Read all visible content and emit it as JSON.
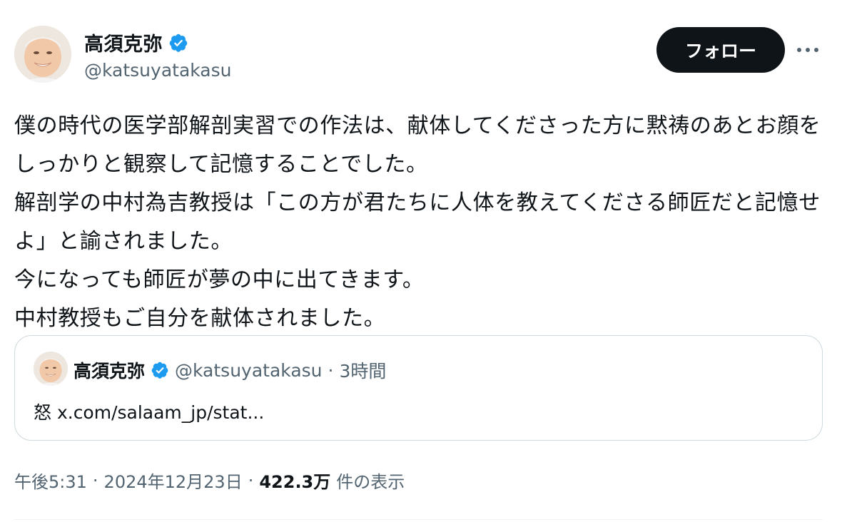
{
  "author": {
    "display_name": "高須克弥",
    "handle": "@katsuyatakasu",
    "verified": true
  },
  "actions": {
    "follow_label": "フォロー",
    "more_icon": "more-horizontal-icon"
  },
  "tweet": {
    "text": "僕の時代の医学部解剖実習での作法は、献体してくださった方に黙祷のあとお顔をしっかりと観察して記憶することでした。\n解剖学の中村為吉教授は「この方が君たちに人体を教えてくださる師匠だと記憶せよ」と諭されました。\n今になっても師匠が夢の中に出てきます。\n中村教授もご自分を献体されました。"
  },
  "quoted_tweet": {
    "display_name": "高須克弥",
    "handle": "@katsuyatakasu",
    "separator": "·",
    "time": "3時間",
    "text": "怒 x.com/salaam_jp/stat..."
  },
  "meta": {
    "time": "午後5:31",
    "separator": "·",
    "date": "2024年12月23日",
    "views_count": "422.3万",
    "views_label": "件の表示"
  },
  "colors": {
    "verified": "#1d9bf0",
    "secondary_text": "#536471",
    "follow_button_bg": "#0f1419",
    "border": "#cfd9de"
  }
}
